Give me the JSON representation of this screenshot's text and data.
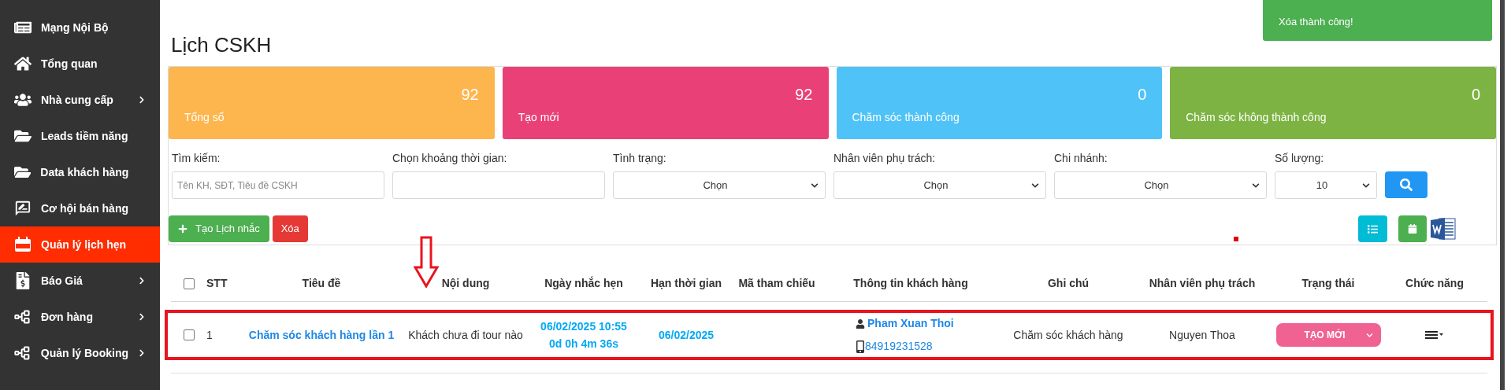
{
  "sidebar": {
    "items": [
      {
        "label": "Mạng Nội Bộ",
        "selected": false,
        "has_submenu": false
      },
      {
        "label": "Tổng quan",
        "selected": false,
        "has_submenu": false
      },
      {
        "label": "Nhà cung cấp",
        "selected": false,
        "has_submenu": true
      },
      {
        "label": "Leads tiềm năng",
        "selected": false,
        "has_submenu": false
      },
      {
        "label": "Data khách hàng",
        "selected": false,
        "has_submenu": false
      },
      {
        "label": "Cơ hội bán hàng",
        "selected": false,
        "has_submenu": false
      },
      {
        "label": "Quản lý lịch hẹn",
        "selected": true,
        "has_submenu": false
      },
      {
        "label": "Báo Giá",
        "selected": false,
        "has_submenu": true
      },
      {
        "label": "Đơn hàng",
        "selected": false,
        "has_submenu": true
      },
      {
        "label": "Quản lý Booking",
        "selected": false,
        "has_submenu": true
      }
    ]
  },
  "page_title": "Lịch CSKH",
  "toast": {
    "message": "Xóa thành công!"
  },
  "stat_cards": [
    {
      "label": "Tổng số",
      "value": "92",
      "color": "#fdb54e"
    },
    {
      "label": "Tạo mới",
      "value": "92",
      "color": "#ea4078"
    },
    {
      "label": "Chăm sóc thành công",
      "value": "0",
      "color": "#4fc3f7"
    },
    {
      "label": "Chăm sóc không thành công",
      "value": "0",
      "color": "#7cb342"
    }
  ],
  "filters": [
    {
      "kind": "input",
      "label": "Tìm kiếm:",
      "placeholder": "Tên KH, SĐT, Tiêu đề CSKH"
    },
    {
      "kind": "input",
      "label": "Chọn khoảng thời gian:"
    },
    {
      "kind": "select",
      "label": "Tình trạng:",
      "value": "Chọn"
    },
    {
      "kind": "select",
      "label": "Nhân viên phụ trách:",
      "value": "Chọn"
    },
    {
      "kind": "select",
      "label": "Chi nhánh:",
      "value": "Chọn"
    },
    {
      "kind": "select",
      "label": "Số lượng:",
      "value": "10"
    }
  ],
  "actions": {
    "create": "Tạo Lịch nhắc",
    "delete": "Xóa"
  },
  "table": {
    "all_checked": false,
    "columns": [
      "STT",
      "Tiêu đề",
      "Nội dung",
      "Ngày nhắc hẹn",
      "Hạn thời gian",
      "Mã tham chiếu",
      "Thông tin khách hàng",
      "Ghi chú",
      "Nhân viên phụ trách",
      "Trạng thái",
      "Chức năng"
    ],
    "rows": [
      {
        "checked": false,
        "highlighted": true,
        "stt": "1",
        "title": "Chăm sóc khách hàng lần 1",
        "content": "Khách chưa đi tour nào",
        "remind_date": "06/02/2025 10:55",
        "countdown": "0d 0h 4m 36s",
        "deadline": "06/02/2025",
        "customer_name": "Pham Xuan Thoi",
        "customer_phone": "84919231528",
        "note": "Chăm sóc khách hàng",
        "staff": "Nguyen Thoa",
        "status": "TẠO MỚI"
      }
    ]
  }
}
